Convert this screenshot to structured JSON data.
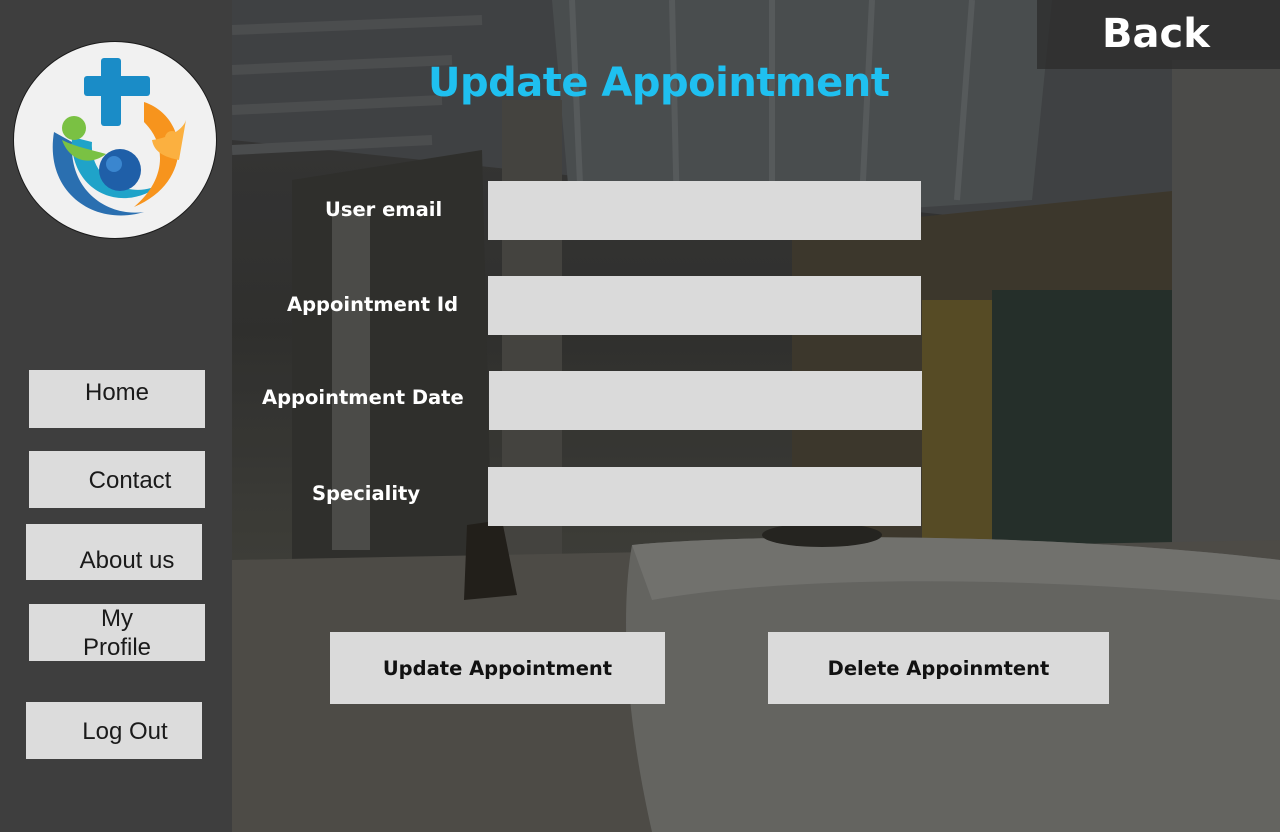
{
  "sidebar": {
    "logo": {
      "icons": [
        "medical-cross-icon",
        "family-care-icon"
      ],
      "colors": {
        "cross": "#1a8cc7",
        "teal": "#2a6fb0",
        "green": "#7ac143",
        "orange": "#f7941d",
        "yellow": "#fbb040"
      }
    },
    "nav": {
      "home": "Home",
      "contact": "Contact",
      "about": "About us",
      "profile_line1": "My",
      "profile_line2": "Profile",
      "logout": "Log Out"
    }
  },
  "header": {
    "back_label": "Back",
    "title": "Update Appointment"
  },
  "form": {
    "user_email": {
      "label": "User email",
      "value": ""
    },
    "appointment_id": {
      "label": "Appointment Id",
      "value": ""
    },
    "appointment_date": {
      "label": "Appointment Date",
      "value": ""
    },
    "speciality": {
      "label": "Speciality",
      "value": ""
    }
  },
  "actions": {
    "update_label": "Update Appointment",
    "delete_label": "Delete Appoinmtent"
  },
  "colors": {
    "title_accent": "#1fc0f0",
    "sidebar_bg": "#3e3e3e",
    "button_bg": "#dcdcdc",
    "input_bg": "#dadada"
  }
}
